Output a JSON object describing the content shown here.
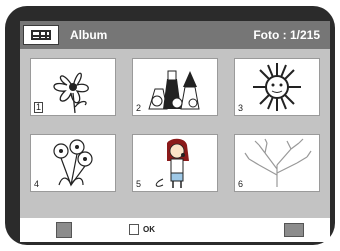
{
  "header": {
    "title": "Album",
    "counter": "Foto : 1/215"
  },
  "thumbnails": [
    {
      "number": "1",
      "picture": "flower-icon",
      "selected": true
    },
    {
      "number": "2",
      "picture": "halloween-kids-icon",
      "selected": false
    },
    {
      "number": "3",
      "picture": "sun-icon",
      "selected": false
    },
    {
      "number": "4",
      "picture": "flowers-icon",
      "selected": false
    },
    {
      "number": "5",
      "picture": "girl-with-microphone-icon",
      "selected": false
    },
    {
      "number": "6",
      "picture": "bare-tree-icon",
      "selected": false
    }
  ],
  "footer": {
    "ok_label": "OK",
    "nav_icon": "navigation-pad-icon",
    "ok_icon": "ok-button-icon",
    "skip_icon": "skip-forward-icon"
  },
  "colors": {
    "frame": "#2b2b2b",
    "screen": "#c3c3c3",
    "titlebar": "#767676"
  }
}
